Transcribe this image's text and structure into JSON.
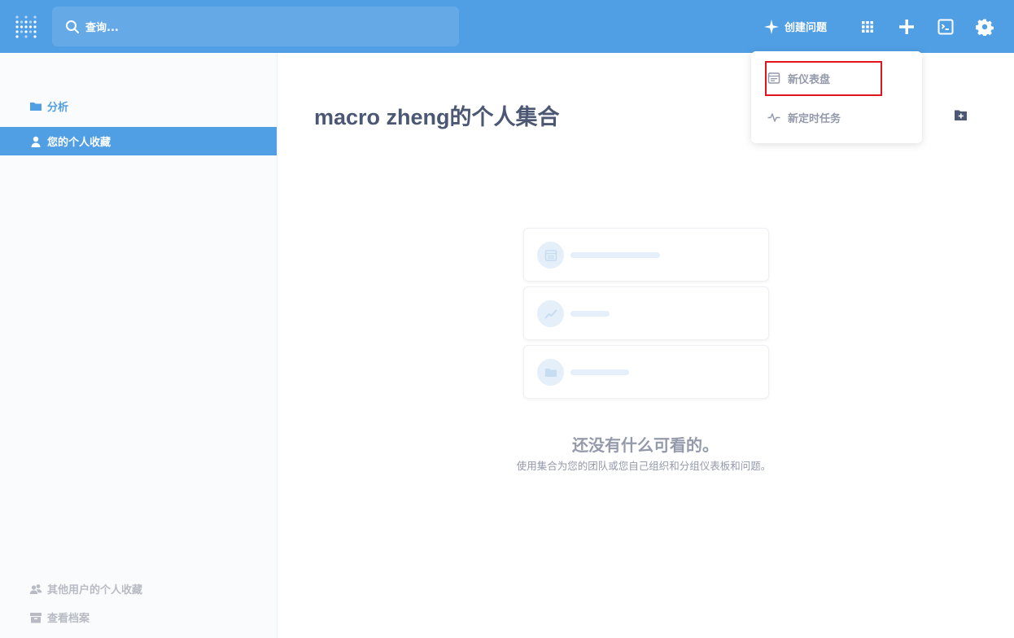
{
  "topbar": {
    "search_placeholder": "查询...",
    "create_question_label": "创建问题"
  },
  "sidebar": {
    "analysis_label": "分析",
    "personal_collection_label": "您的个人收藏",
    "other_users_label": "其他用户的个人收藏",
    "archive_label": "查看档案"
  },
  "main": {
    "title": "macro zheng的个人集合",
    "empty_title": "还没有什么可看的。",
    "empty_subtitle": "使用集合为您的团队或您自己组织和分组仪表板和问题。"
  },
  "new_menu": {
    "items": [
      {
        "label": "新仪表盘",
        "icon": "dashboard-icon"
      },
      {
        "label": "新定时任务",
        "icon": "pulse-icon"
      }
    ]
  },
  "colors": {
    "brand": "#509ee3",
    "text_dark": "#4c5773",
    "text_muted": "#949aab",
    "highlight": "#e0141e"
  }
}
